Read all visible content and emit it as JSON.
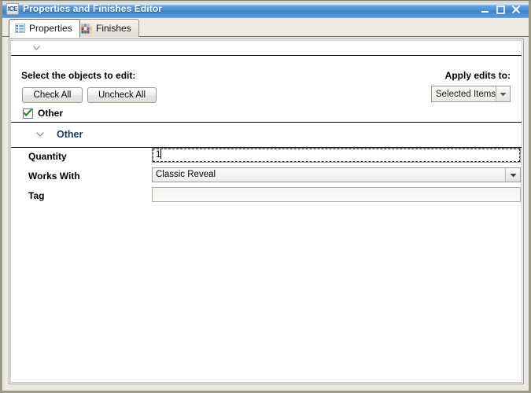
{
  "window": {
    "title": "Properties and Finishes Editor",
    "app_icon_text": "ICE",
    "controls": {
      "minimize": "minimize-icon",
      "maximize": "maximize-icon",
      "close": "close-icon"
    }
  },
  "tabs": [
    {
      "label": "Properties",
      "icon": "list-icon",
      "active": true
    },
    {
      "label": "Finishes",
      "icon": "color-swatches-icon",
      "active": false
    }
  ],
  "panel": {
    "top_collapse_chevron": "chevron-down-icon",
    "select_section": {
      "heading": "Select the objects to edit:",
      "check_all_label": "Check All",
      "uncheck_all_label": "Uncheck All",
      "checkbox": {
        "label": "Other",
        "checked": true
      }
    },
    "apply_edits": {
      "label": "Apply edits to:",
      "selected_value": "Selected Items",
      "options": [
        "Selected Items"
      ]
    },
    "group": {
      "chevron": "chevron-down-icon",
      "title": "Other"
    },
    "fields": [
      {
        "label": "Quantity",
        "type": "text",
        "value": "1",
        "focused": true
      },
      {
        "label": "Works With",
        "type": "combo",
        "value": "Classic Reveal",
        "focused": false
      },
      {
        "label": "Tag",
        "type": "text",
        "value": "",
        "focused": false
      }
    ]
  },
  "colors": {
    "titlebar_blue": "#4a8ed0",
    "group_title": "#1c3a5e",
    "check_green": "#1f8a28",
    "frame_olive": "#9a9a86"
  }
}
